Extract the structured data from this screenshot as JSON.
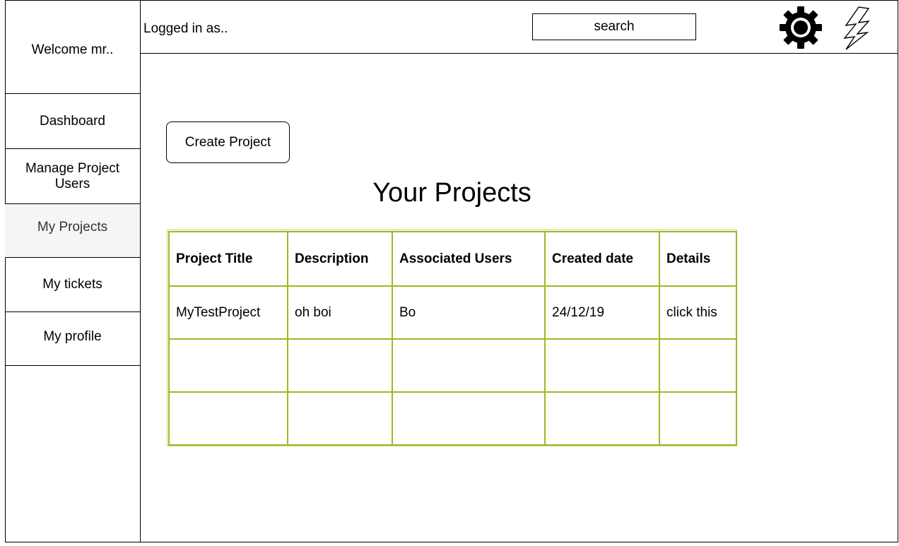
{
  "sidebar": {
    "welcome": "Welcome mr..",
    "items": [
      {
        "label": "Dashboard"
      },
      {
        "label": "Manage Project Users"
      },
      {
        "label": "My Projects"
      },
      {
        "label": "My tickets"
      },
      {
        "label": "My profile"
      }
    ],
    "active_index": 2
  },
  "header": {
    "logged_in": "Logged in as..",
    "search_label": "search",
    "icons": [
      "gear-icon",
      "lightning-icon"
    ]
  },
  "main": {
    "create_button": "Create Project",
    "heading": "Your Projects",
    "table": {
      "columns": [
        "Project Title",
        "Description",
        "Associated Users",
        "Created date",
        "Details"
      ],
      "rows": [
        [
          "MyTestProject",
          "oh boi",
          "Bo",
          "24/12/19",
          "click this"
        ],
        [
          "",
          "",
          "",
          "",
          ""
        ],
        [
          "",
          "",
          "",
          "",
          ""
        ]
      ]
    }
  },
  "colors": {
    "table_border": "#99bb22",
    "table_outer_border": "#c7d77f",
    "active_nav_bg": "#f5f5f5"
  }
}
